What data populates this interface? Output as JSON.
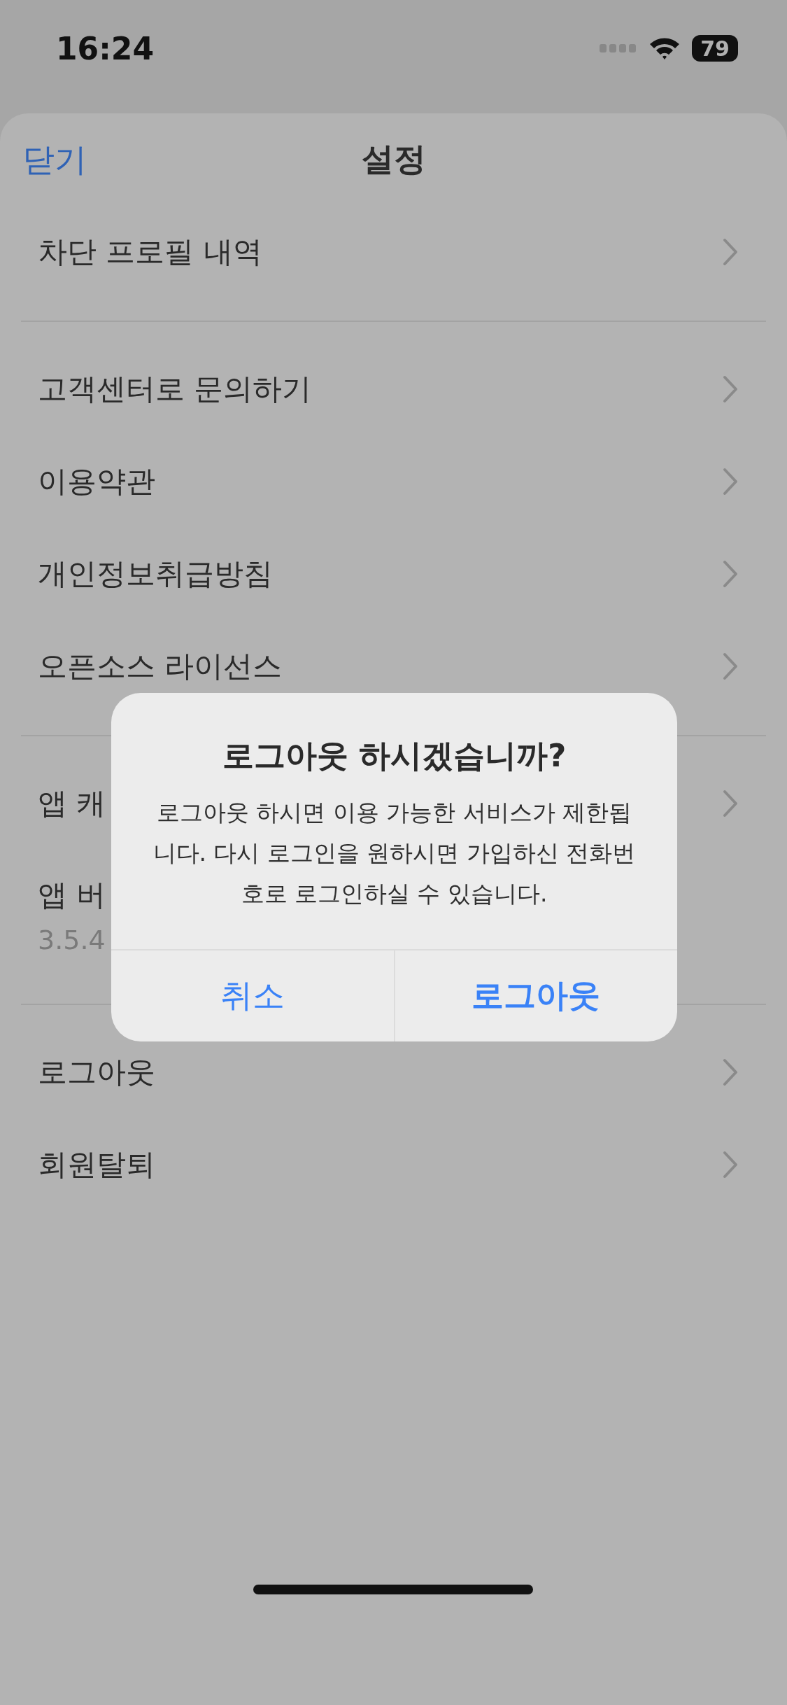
{
  "status_bar": {
    "time": "16:24",
    "battery": "79"
  },
  "nav": {
    "close": "닫기",
    "title": "설정"
  },
  "sections": [
    {
      "rows": [
        {
          "kind": "link",
          "label": "차단 프로필 내역"
        }
      ]
    },
    {
      "rows": [
        {
          "kind": "link",
          "label": "고객센터로 문의하기"
        },
        {
          "kind": "link",
          "label": "이용약관"
        },
        {
          "kind": "link",
          "label": "개인정보취급방침"
        },
        {
          "kind": "link",
          "label": "오픈소스 라이선스"
        }
      ]
    },
    {
      "rows": [
        {
          "kind": "link",
          "label": "앱 캐"
        },
        {
          "kind": "info",
          "label": "앱 버",
          "detail": "3.5.4"
        }
      ]
    },
    {
      "rows": [
        {
          "kind": "link",
          "label": "로그아웃"
        },
        {
          "kind": "link",
          "label": "회원탈퇴"
        }
      ]
    }
  ],
  "dialog": {
    "title": "로그아웃 하시겠습니까?",
    "message": "로그아웃 하시면 이용 가능한 서비스가 제한됩니다. 다시 로그인을 원하시면 가입하신 전화번호로 로그인하실 수 있습니다.",
    "buttons": [
      {
        "kind": "cancel",
        "label": "취소"
      },
      {
        "kind": "primary",
        "label": "로그아웃"
      }
    ]
  }
}
